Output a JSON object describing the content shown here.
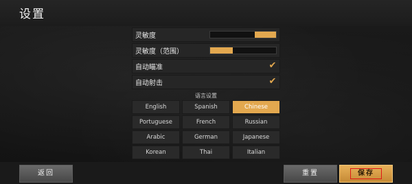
{
  "header": {
    "title": "设置"
  },
  "settings": {
    "sensitivity": {
      "label": "灵敏度",
      "value": 0.32
    },
    "sensitivity_scope": {
      "label": "灵敏度（范围）",
      "value": 0.34
    },
    "auto_aim": {
      "label": "自动瞄准",
      "checked": true,
      "check_glyph": "✔"
    },
    "auto_fire": {
      "label": "自动射击",
      "checked": true,
      "check_glyph": "✔"
    }
  },
  "language": {
    "title": "语言设置",
    "selected": "Chinese",
    "options": [
      "English",
      "Spanish",
      "Chinese",
      "Portuguese",
      "French",
      "Russian",
      "Arabic",
      "German",
      "Japanese",
      "Korean",
      "Thai",
      "Italian"
    ]
  },
  "footer": {
    "back_label": "返回",
    "reset_label": "重置",
    "save_label": "保存"
  },
  "colors": {
    "accent": "#e3a84f",
    "highlight_border": "#e01515"
  }
}
